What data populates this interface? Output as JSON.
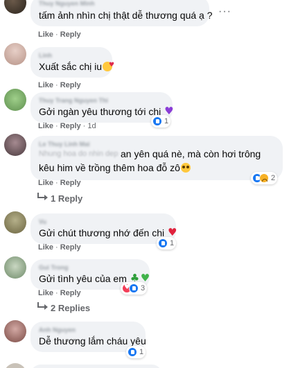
{
  "colors": {
    "bubble": "#f0f2f5",
    "meta": "#65676b",
    "like": "#1877f2",
    "heart": "#f33e58"
  },
  "actions": {
    "like": "Like",
    "reply": "Reply",
    "separator": "·"
  },
  "comments": [
    {
      "text": "tấm ảnh nhìn chị thật dễ thương quá ạ ?",
      "time": "",
      "reaction_count": ""
    },
    {
      "text": "Xuất sắc chị iu",
      "time": "",
      "reaction_count": ""
    },
    {
      "text": "Gởi ngàn yêu thương tới chị",
      "time": "1d",
      "reaction_count": "1"
    },
    {
      "text_line1": "an yên quá nè, mà còn hơi trông",
      "text_line2": "kêu him về trồng thêm hoa đỗ zô",
      "time": "",
      "reaction_count": "2"
    },
    {
      "text": "Gửi chút thương nhớ đến chị",
      "time": "",
      "reaction_count": "1"
    },
    {
      "text": "Gửi tình yêu của em",
      "time": "",
      "reaction_count": "3"
    },
    {
      "text": "Dễ thương lắm cháu yêu",
      "time": "",
      "reaction_count": "1"
    }
  ],
  "replies": [
    {
      "label": "1 Reply"
    },
    {
      "label": "2 Replies"
    }
  ],
  "icons": [
    "more-dots-icon",
    "like-reaction-icon",
    "heart-reaction-icon",
    "sad-reaction-icon",
    "reply-arrow-icon"
  ]
}
